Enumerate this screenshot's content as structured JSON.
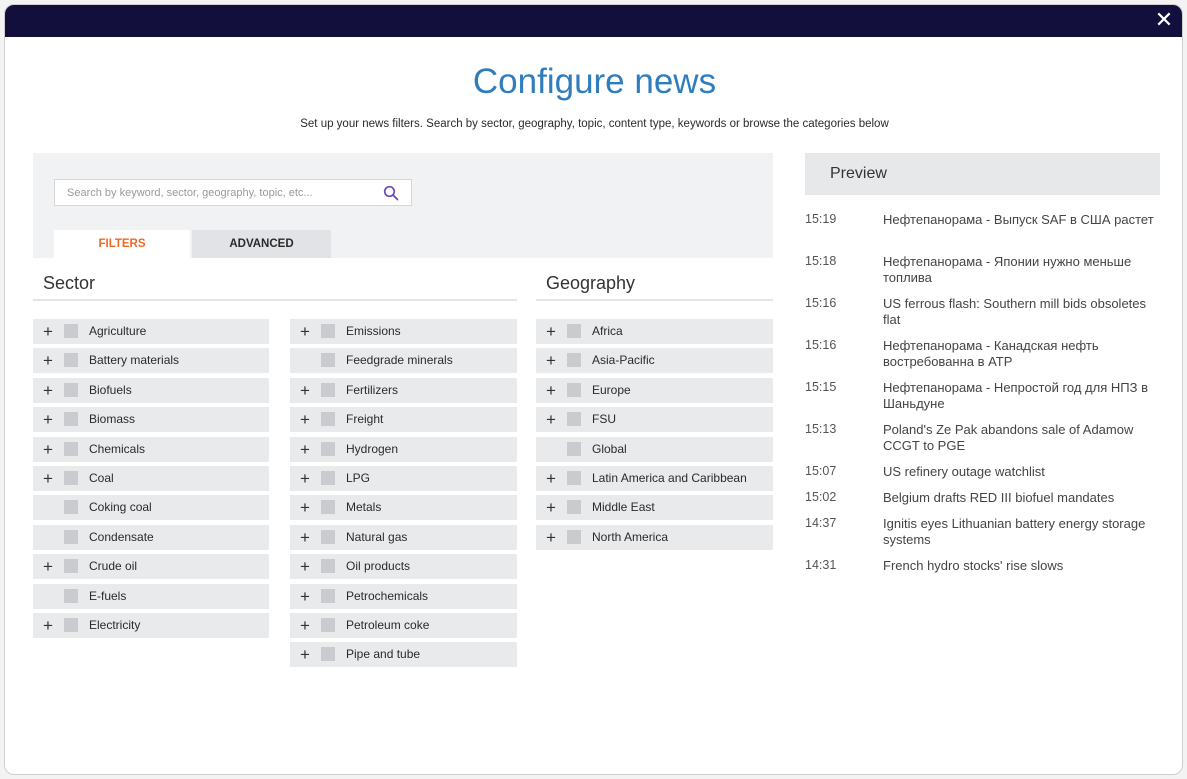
{
  "window": {
    "close_glyph": "✕"
  },
  "header": {
    "title": "Configure news",
    "subtitle": "Set up your news filters. Search by sector, geography, topic, content type, keywords or browse the categories below"
  },
  "search": {
    "placeholder": "Search by keyword, sector, geography, topic, etc...",
    "icon": "search-icon"
  },
  "tabs": {
    "filters": "FILTERS",
    "advanced": "ADVANCED",
    "active": "filters",
    "active_color": "#ec6a24"
  },
  "sector": {
    "heading": "Sector",
    "col1": [
      {
        "label": "Agriculture",
        "expandable": true
      },
      {
        "label": "Battery materials",
        "expandable": true
      },
      {
        "label": "Biofuels",
        "expandable": true
      },
      {
        "label": "Biomass",
        "expandable": true
      },
      {
        "label": "Chemicals",
        "expandable": true
      },
      {
        "label": "Coal",
        "expandable": true
      },
      {
        "label": "Coking coal",
        "expandable": false
      },
      {
        "label": "Condensate",
        "expandable": false
      },
      {
        "label": "Crude oil",
        "expandable": true
      },
      {
        "label": "E-fuels",
        "expandable": false
      },
      {
        "label": "Electricity",
        "expandable": true
      }
    ],
    "col2": [
      {
        "label": "Emissions",
        "expandable": true
      },
      {
        "label": "Feedgrade minerals",
        "expandable": false
      },
      {
        "label": "Fertilizers",
        "expandable": true
      },
      {
        "label": "Freight",
        "expandable": true
      },
      {
        "label": "Hydrogen",
        "expandable": true
      },
      {
        "label": "LPG",
        "expandable": true
      },
      {
        "label": "Metals",
        "expandable": true
      },
      {
        "label": "Natural gas",
        "expandable": true
      },
      {
        "label": "Oil products",
        "expandable": true
      },
      {
        "label": "Petrochemicals",
        "expandable": true
      },
      {
        "label": "Petroleum coke",
        "expandable": true
      },
      {
        "label": "Pipe and tube",
        "expandable": true
      }
    ]
  },
  "geography": {
    "heading": "Geography",
    "items": [
      {
        "label": "Africa",
        "expandable": true
      },
      {
        "label": "Asia-Pacific",
        "expandable": true
      },
      {
        "label": "Europe",
        "expandable": true
      },
      {
        "label": "FSU",
        "expandable": true
      },
      {
        "label": "Global",
        "expandable": false
      },
      {
        "label": "Latin America and Caribbean",
        "expandable": true
      },
      {
        "label": "Middle East",
        "expandable": true
      },
      {
        "label": "North America",
        "expandable": true
      }
    ]
  },
  "preview": {
    "heading": "Preview",
    "items": [
      {
        "time": "15:19",
        "headline": "Нефтепанорама - Выпуск SAF в США растет"
      },
      {
        "time": "15:18",
        "headline": "Нефтепанорама - Японии нужно меньше топлива"
      },
      {
        "time": "15:16",
        "headline": "US ferrous flash: Southern mill bids obsoletes flat"
      },
      {
        "time": "15:16",
        "headline": "Нефтепанорама - Канадская нефть востребованна в АТР"
      },
      {
        "time": "15:15",
        "headline": "Нефтепанорама - Непростой год для НПЗ в Шаньдуне"
      },
      {
        "time": "15:13",
        "headline": "Poland's Ze Pak abandons sale of Adamow CCGT to PGE"
      },
      {
        "time": "15:07",
        "headline": "US refinery outage watchlist"
      },
      {
        "time": "15:02",
        "headline": "Belgium drafts RED III biofuel mandates"
      },
      {
        "time": "14:37",
        "headline": "Ignitis eyes Lithuanian battery energy storage systems"
      },
      {
        "time": "14:31",
        "headline": "French hydro stocks' rise slows"
      }
    ]
  },
  "colors": {
    "topbar": "#120f3d",
    "title": "#2f7dbd",
    "accent": "#ec6a24"
  }
}
